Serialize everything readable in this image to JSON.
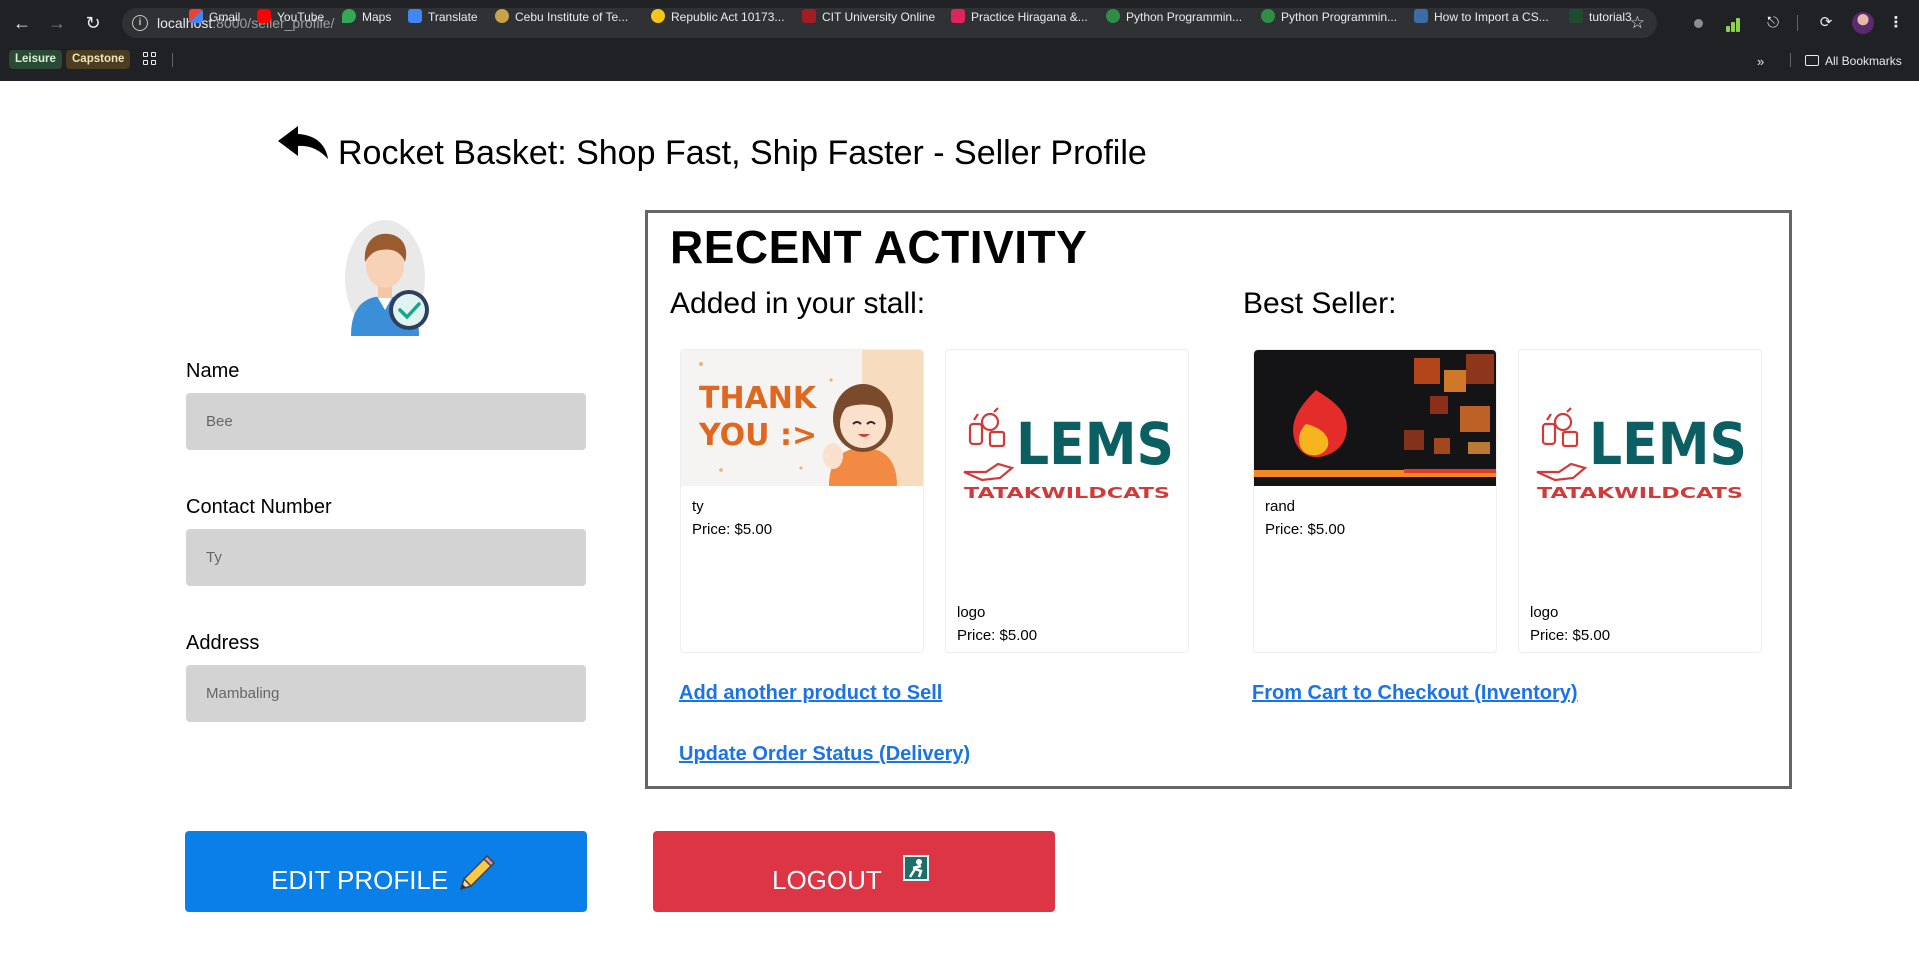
{
  "browser": {
    "url_host": "localhost",
    "url_path": ":8000/seller_profile/",
    "bookmarks": [
      {
        "label": "Gmail"
      },
      {
        "label": "YouTube"
      },
      {
        "label": "Maps"
      },
      {
        "label": "Translate"
      },
      {
        "label": "Cebu Institute of Te..."
      },
      {
        "label": "Republic Act 10173..."
      },
      {
        "label": "CIT University Online"
      },
      {
        "label": "Practice Hiragana &..."
      },
      {
        "label": "Python Programmin..."
      },
      {
        "label": "Python Programmin..."
      },
      {
        "label": "How to Import a CS..."
      },
      {
        "label": "tutorial3"
      }
    ],
    "chips": {
      "leisure": "Leisure",
      "capstone": "Capstone"
    },
    "all_bookmarks": "All Bookmarks"
  },
  "page": {
    "title": "Rocket Basket: Shop Fast, Ship Faster - Seller Profile"
  },
  "profile": {
    "name_label": "Name",
    "name_placeholder": "Bee",
    "contact_label": "Contact Number",
    "contact_placeholder": "Ty",
    "address_label": "Address",
    "address_placeholder": "Mambaling"
  },
  "activity": {
    "title": "RECENT ACTIVITY",
    "added_heading": "Added in your stall:",
    "best_heading": "Best Seller:",
    "added_products": [
      {
        "name": "ty",
        "price": "Price: $5.00"
      },
      {
        "name": "logo",
        "price": "Price: $5.00"
      }
    ],
    "best_products": [
      {
        "name": "rand",
        "price": "Price: $5.00"
      },
      {
        "name": "logo",
        "price": "Price: $5.00"
      }
    ],
    "thank_you_text_1": "THANK",
    "thank_you_text_2": "YOU :>",
    "lems_text": "LEMS",
    "lems_sub": "TATAKWILDCATS",
    "links": {
      "add_product": "Add another product to Sell",
      "checkout": "From Cart to Checkout (Inventory)",
      "update_status": "Update Order Status (Delivery)"
    }
  },
  "actions": {
    "edit_label": "EDIT PROFILE",
    "logout_label": "LOGOUT"
  },
  "colors": {
    "edit_button": "#0b7fe8",
    "logout_button": "#dc3545",
    "link": "#1a73e8",
    "lems_teal": "#0b5f62",
    "lems_red": "#d23a3a"
  }
}
